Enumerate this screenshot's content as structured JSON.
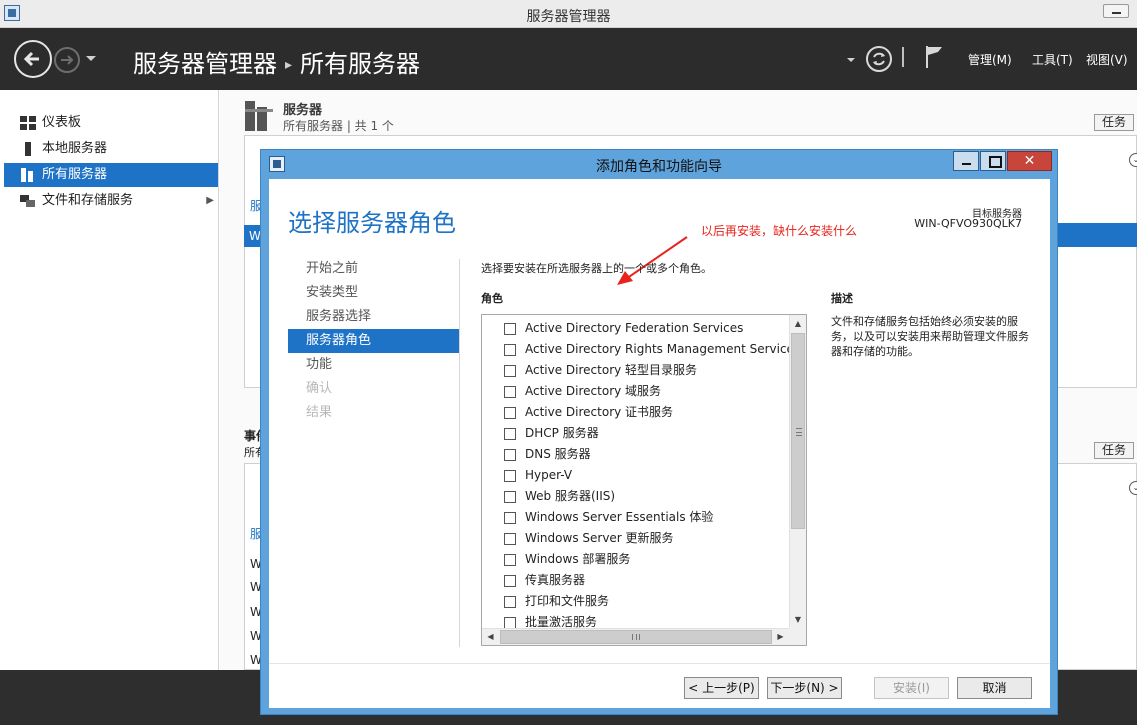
{
  "window": {
    "title": "服务器管理器"
  },
  "header": {
    "breadcrumb_root": "服务器管理器",
    "breadcrumb_sep": "▸",
    "breadcrumb_current": "所有服务器",
    "menu_manage": "管理(M)",
    "menu_tools": "工具(T)",
    "menu_view": "视图(V)"
  },
  "sidebar": {
    "items": [
      {
        "label": "仪表板",
        "icon": "dashboard-icon"
      },
      {
        "label": "本地服务器",
        "icon": "server-icon"
      },
      {
        "label": "所有服务器",
        "icon": "servers-icon",
        "active": true
      },
      {
        "label": "文件和存储服务",
        "icon": "storage-icon"
      }
    ],
    "expand_glyph": "▶"
  },
  "background": {
    "servers_title": "服务器",
    "servers_subtitle": "所有服务器 | 共 1 个",
    "tasks_label": "任务",
    "tasks_label_2": "任务",
    "frag_s1": "服",
    "frag_w1": "W",
    "frag_ev": "事件",
    "frag_all": "所有",
    "frag_s2": "服",
    "frag_w": "W"
  },
  "dialog": {
    "title": "添加角色和功能向导",
    "page_title": "选择服务器角色",
    "target_label": "目标服务器",
    "target_server": "WIN-QFVO930QLK7",
    "annotation": "以后再安装，缺什么安装什么",
    "instruction": "选择要安装在所选服务器上的一个或多个角色。",
    "roles_header": "角色",
    "description_header": "描述",
    "description_text": "文件和存储服务包括始终必须安装的服务，以及可以安装用来帮助管理文件服务器和存储的功能。",
    "steps": [
      {
        "label": "开始之前",
        "state": "normal"
      },
      {
        "label": "安装类型",
        "state": "normal"
      },
      {
        "label": "服务器选择",
        "state": "normal"
      },
      {
        "label": "服务器角色",
        "state": "active"
      },
      {
        "label": "功能",
        "state": "normal"
      },
      {
        "label": "确认",
        "state": "disabled"
      },
      {
        "label": "结果",
        "state": "disabled"
      }
    ],
    "roles": [
      {
        "label": "Active Directory Federation Services",
        "checked": false
      },
      {
        "label": "Active Directory Rights Management Services",
        "checked": false
      },
      {
        "label": "Active Directory 轻型目录服务",
        "checked": false
      },
      {
        "label": "Active Directory 域服务",
        "checked": false
      },
      {
        "label": "Active Directory 证书服务",
        "checked": false
      },
      {
        "label": "DHCP 服务器",
        "checked": false
      },
      {
        "label": "DNS 服务器",
        "checked": false
      },
      {
        "label": "Hyper-V",
        "checked": false
      },
      {
        "label": "Web 服务器(IIS)",
        "checked": false
      },
      {
        "label": "Windows Server Essentials 体验",
        "checked": false
      },
      {
        "label": "Windows Server 更新服务",
        "checked": false
      },
      {
        "label": "Windows 部署服务",
        "checked": false
      },
      {
        "label": "传真服务器",
        "checked": false
      },
      {
        "label": "打印和文件服务",
        "checked": false
      },
      {
        "label": "批量激活服务",
        "checked": false
      }
    ],
    "buttons": {
      "previous": "< 上一步(P)",
      "next": "下一步(N) >",
      "install": "安装(I)",
      "cancel": "取消"
    }
  },
  "colors": {
    "accent": "#1f73c6",
    "annotation": "#e8231c",
    "header_bg": "#2c2c2c",
    "dialog_frame": "#5fa3dc"
  }
}
